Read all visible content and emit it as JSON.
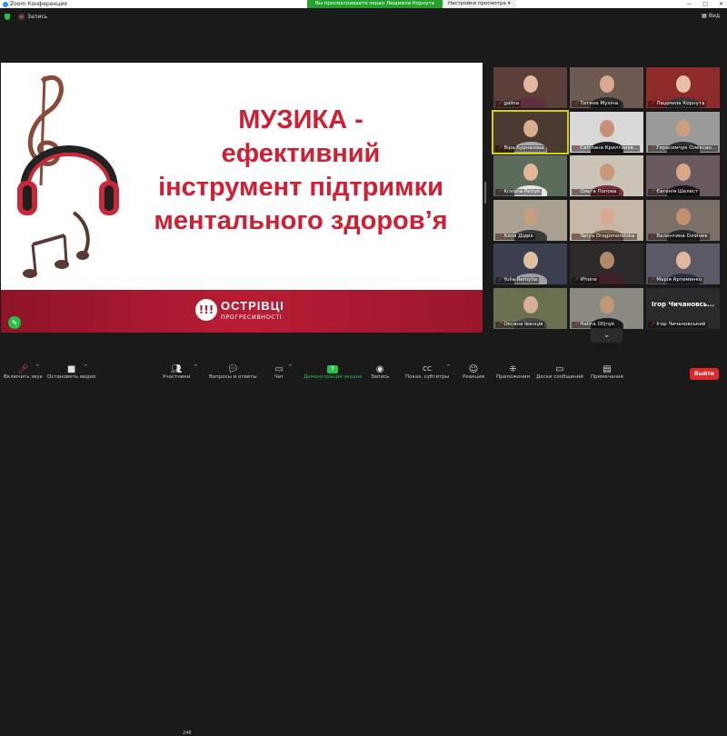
{
  "window": {
    "app_title": "Zoom Конференция",
    "controls": [
      "—",
      "□",
      "✕"
    ]
  },
  "share_bar": {
    "viewing_text": "Вы просматриваете экран Людмила Корнута",
    "view_options": "Настройки просмотра"
  },
  "topbar": {
    "record_label": "Запись",
    "view_label": "Вид"
  },
  "slide": {
    "title_lines": [
      "МУЗИКА -",
      "ефективний",
      "інструмент підтримки",
      "ментального здоров’я"
    ],
    "logo_glyph": "!!!",
    "brand_name": "ОСТРІВЦІ",
    "brand_sub": "ПРОГРЕСИВНОСТІ",
    "accent_color": "#cf1f33"
  },
  "participants": [
    {
      "name": "galina"
    },
    {
      "name": "Тетяна Мухіна"
    },
    {
      "name": "Людмила Корнута"
    },
    {
      "name": "Віра Бурназова"
    },
    {
      "name": "Світлана Крилтанов..."
    },
    {
      "name": "Герасимчук Олексан..."
    },
    {
      "name": "Kristina Petryk"
    },
    {
      "name": "Ольга Попова"
    },
    {
      "name": "Євгенія Шелест"
    },
    {
      "name": "Алла Дідик"
    },
    {
      "name": "Tanya Dragomeretska"
    },
    {
      "name": "Валентина Олійник"
    },
    {
      "name": "Yulia Remyha"
    },
    {
      "name": "iPhone"
    },
    {
      "name": "Марія Артеменко"
    },
    {
      "name": "Оксана Іванців"
    },
    {
      "name": "Halina Olijnyk"
    },
    {
      "name": "Ігор Чичановський",
      "display": "Ігор  Чичановсь..."
    }
  ],
  "toolbar": {
    "mute": "Включить звук",
    "video": "Остановить видео",
    "participants": "Участники",
    "participants_count": "246",
    "qa": "Вопросы и ответы",
    "chat": "Чат",
    "share": "Демонстрация экрана",
    "record": "Запись",
    "subtitles": "Показ. субтитры",
    "reactions": "Реакция",
    "apps": "Приложения",
    "whiteboard": "Доски сообщений",
    "notes": "Примечания",
    "leave": "Выйти"
  }
}
